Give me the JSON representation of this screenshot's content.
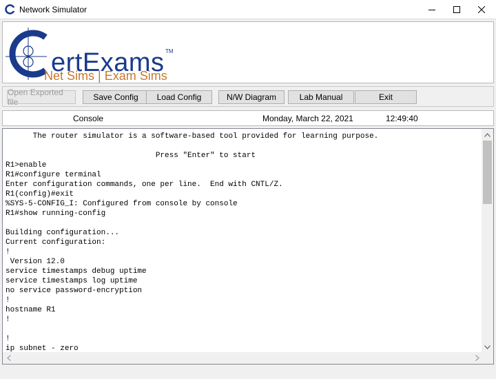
{
  "window": {
    "title": "Network Simulator",
    "icon": "certexams-c-icon",
    "controls": [
      "minimize-icon",
      "maximize-icon",
      "close-icon"
    ]
  },
  "logo": {
    "brand_first_letter": "C",
    "brand_rest": "ertExams",
    "trademark": "TM",
    "tagline": "Net Sims | Exam Sims",
    "colors": {
      "brand": "#1a3a8c",
      "tagline": "#c8782a"
    }
  },
  "toolbar": {
    "buttons": [
      {
        "label": "Open Exported file",
        "enabled": false
      },
      {
        "label": "Save Config",
        "enabled": true
      },
      {
        "label": "Load Config",
        "enabled": true
      },
      {
        "label": "N/W Diagram",
        "enabled": true
      },
      {
        "label": "Lab Manual",
        "enabled": true
      },
      {
        "label": "Exit",
        "enabled": true
      }
    ]
  },
  "status": {
    "mode": "Console",
    "date": "Monday, March 22, 2021",
    "time": "12:49:40"
  },
  "console": {
    "lines": [
      "      The router simulator is a software-based tool provided for learning purpose.",
      "",
      "                                 Press \"Enter\" to start",
      "R1>enable",
      "R1#configure terminal",
      "Enter configuration commands, one per line.  End with CNTL/Z.",
      "R1(config)#exit",
      "%SYS-5-CONFIG_I: Configured from console by console",
      "R1#show running-config",
      "",
      "Building configuration...",
      "Current configuration:",
      "!",
      " Version 12.0",
      "service timestamps debug uptime",
      "service timestamps log uptime",
      "no service password-encryption",
      "!",
      "hostname R1",
      "!",
      "",
      "!",
      "ip subnet - zero"
    ]
  }
}
